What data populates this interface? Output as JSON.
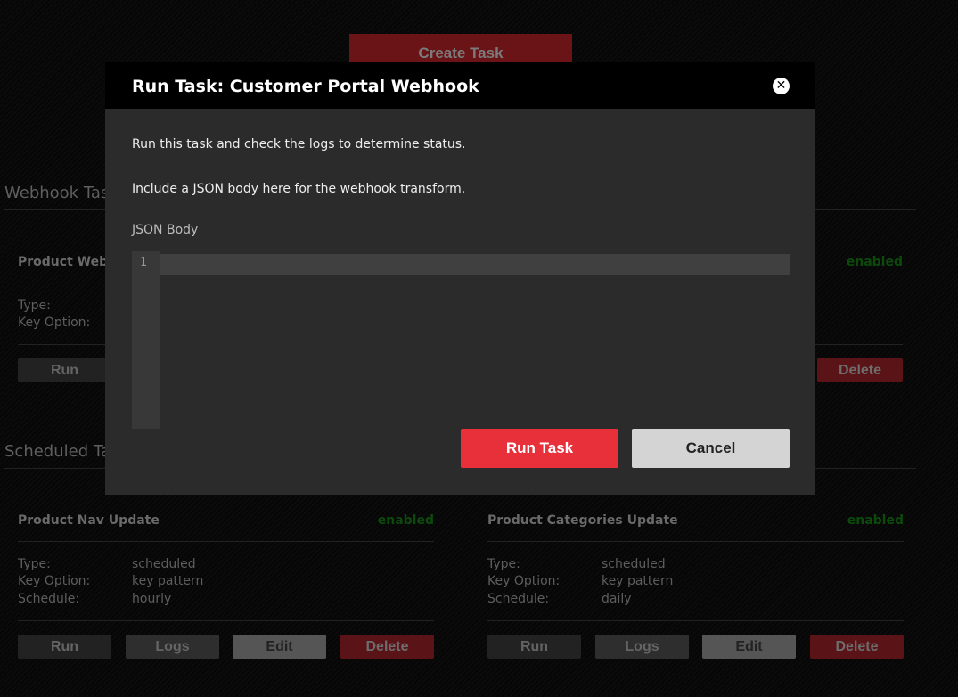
{
  "create_task": "Create Task",
  "sections": {
    "webhook": "Webhook Tas",
    "scheduled": "Scheduled Ta"
  },
  "webhook_card": {
    "title": "Product Web",
    "status": "enabled",
    "labels": [
      "Type:",
      "Key Option:"
    ],
    "buttons": {
      "run": "Run",
      "delete": "Delete"
    }
  },
  "scheduled_cards": [
    {
      "title": "Product Nav Update",
      "status": "enabled",
      "rows": [
        {
          "label": "Type:",
          "value": "scheduled"
        },
        {
          "label": "Key Option:",
          "value": "key pattern"
        },
        {
          "label": "Schedule:",
          "value": "hourly"
        }
      ],
      "buttons": {
        "run": "Run",
        "logs": "Logs",
        "edit": "Edit",
        "delete": "Delete"
      }
    },
    {
      "title": "Product Categories Update",
      "status": "enabled",
      "rows": [
        {
          "label": "Type:",
          "value": "scheduled"
        },
        {
          "label": "Key Option:",
          "value": "key pattern"
        },
        {
          "label": "Schedule:",
          "value": "daily"
        }
      ],
      "buttons": {
        "run": "Run",
        "logs": "Logs",
        "edit": "Edit",
        "delete": "Delete"
      }
    }
  ],
  "modal": {
    "title": "Run Task: Customer Portal Webhook",
    "close_icon": "close-circle-icon",
    "text1": "Run this task and check the logs to determine status.",
    "text2": "Include a JSON body here for the webhook transform.",
    "json_label": "JSON Body",
    "line_number": "1",
    "run_label": "Run Task",
    "cancel_label": "Cancel"
  },
  "colors": {
    "accent": "#e8303a",
    "enabled": "#0c4a0c"
  }
}
